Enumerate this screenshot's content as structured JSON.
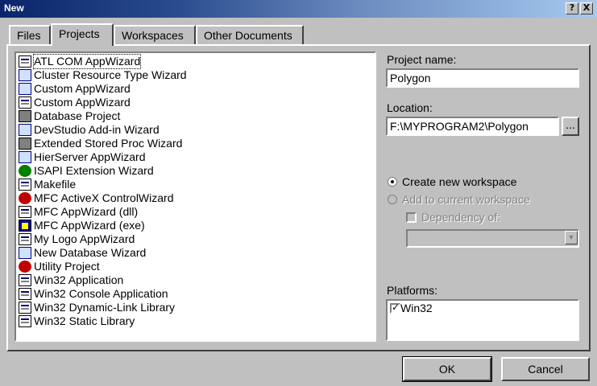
{
  "window": {
    "title": "New"
  },
  "titlebar_buttons": {
    "help": "?",
    "close": "X"
  },
  "tabs": [
    {
      "label": "Files"
    },
    {
      "label": "Projects",
      "active": true
    },
    {
      "label": "Workspaces"
    },
    {
      "label": "Other Documents"
    }
  ],
  "project_types": [
    {
      "label": "ATL COM AppWizard",
      "icon": "atl-icon"
    },
    {
      "label": "Cluster Resource Type Wizard",
      "icon": "wizard-icon"
    },
    {
      "label": "Custom AppWizard",
      "icon": "wizard-icon"
    },
    {
      "label": "Custom AppWizard",
      "icon": "window-icon"
    },
    {
      "label": "Database Project",
      "icon": "database-icon"
    },
    {
      "label": "DevStudio Add-in Wizard",
      "icon": "addin-icon"
    },
    {
      "label": "Extended Stored Proc Wizard",
      "icon": "stored-proc-icon"
    },
    {
      "label": "HierServer AppWizard",
      "icon": "hierserver-icon"
    },
    {
      "label": "ISAPI Extension Wizard",
      "icon": "globe-icon"
    },
    {
      "label": "Makefile",
      "icon": "makefile-icon"
    },
    {
      "label": "MFC ActiveX ControlWizard",
      "icon": "activex-icon"
    },
    {
      "label": "MFC AppWizard (dll)",
      "icon": "mfc-dll-icon"
    },
    {
      "label": "MFC AppWizard (exe)",
      "icon": "mfc-exe-icon"
    },
    {
      "label": "My Logo AppWizard",
      "icon": "window-icon"
    },
    {
      "label": "New Database Wizard",
      "icon": "new-db-icon"
    },
    {
      "label": "Utility Project",
      "icon": "utility-icon"
    },
    {
      "label": "Win32 Application",
      "icon": "win32-app-icon"
    },
    {
      "label": "Win32 Console Application",
      "icon": "console-icon"
    },
    {
      "label": "Win32 Dynamic-Link Library",
      "icon": "dll-icon"
    },
    {
      "label": "Win32 Static Library",
      "icon": "lib-icon"
    }
  ],
  "project_name": {
    "label": "Project name:",
    "value": "Polygon"
  },
  "location": {
    "label": "Location:",
    "value": "F:\\MYPROGRAM2\\Polygon",
    "browse": "..."
  },
  "workspace": {
    "create_new": "Create new workspace",
    "add_to_current": "Add to current workspace",
    "dependency_of": "Dependency of:"
  },
  "platforms": {
    "label": "Platforms:",
    "items": [
      {
        "label": "Win32",
        "checked": true
      }
    ]
  },
  "buttons": {
    "ok": "OK",
    "cancel": "Cancel"
  }
}
